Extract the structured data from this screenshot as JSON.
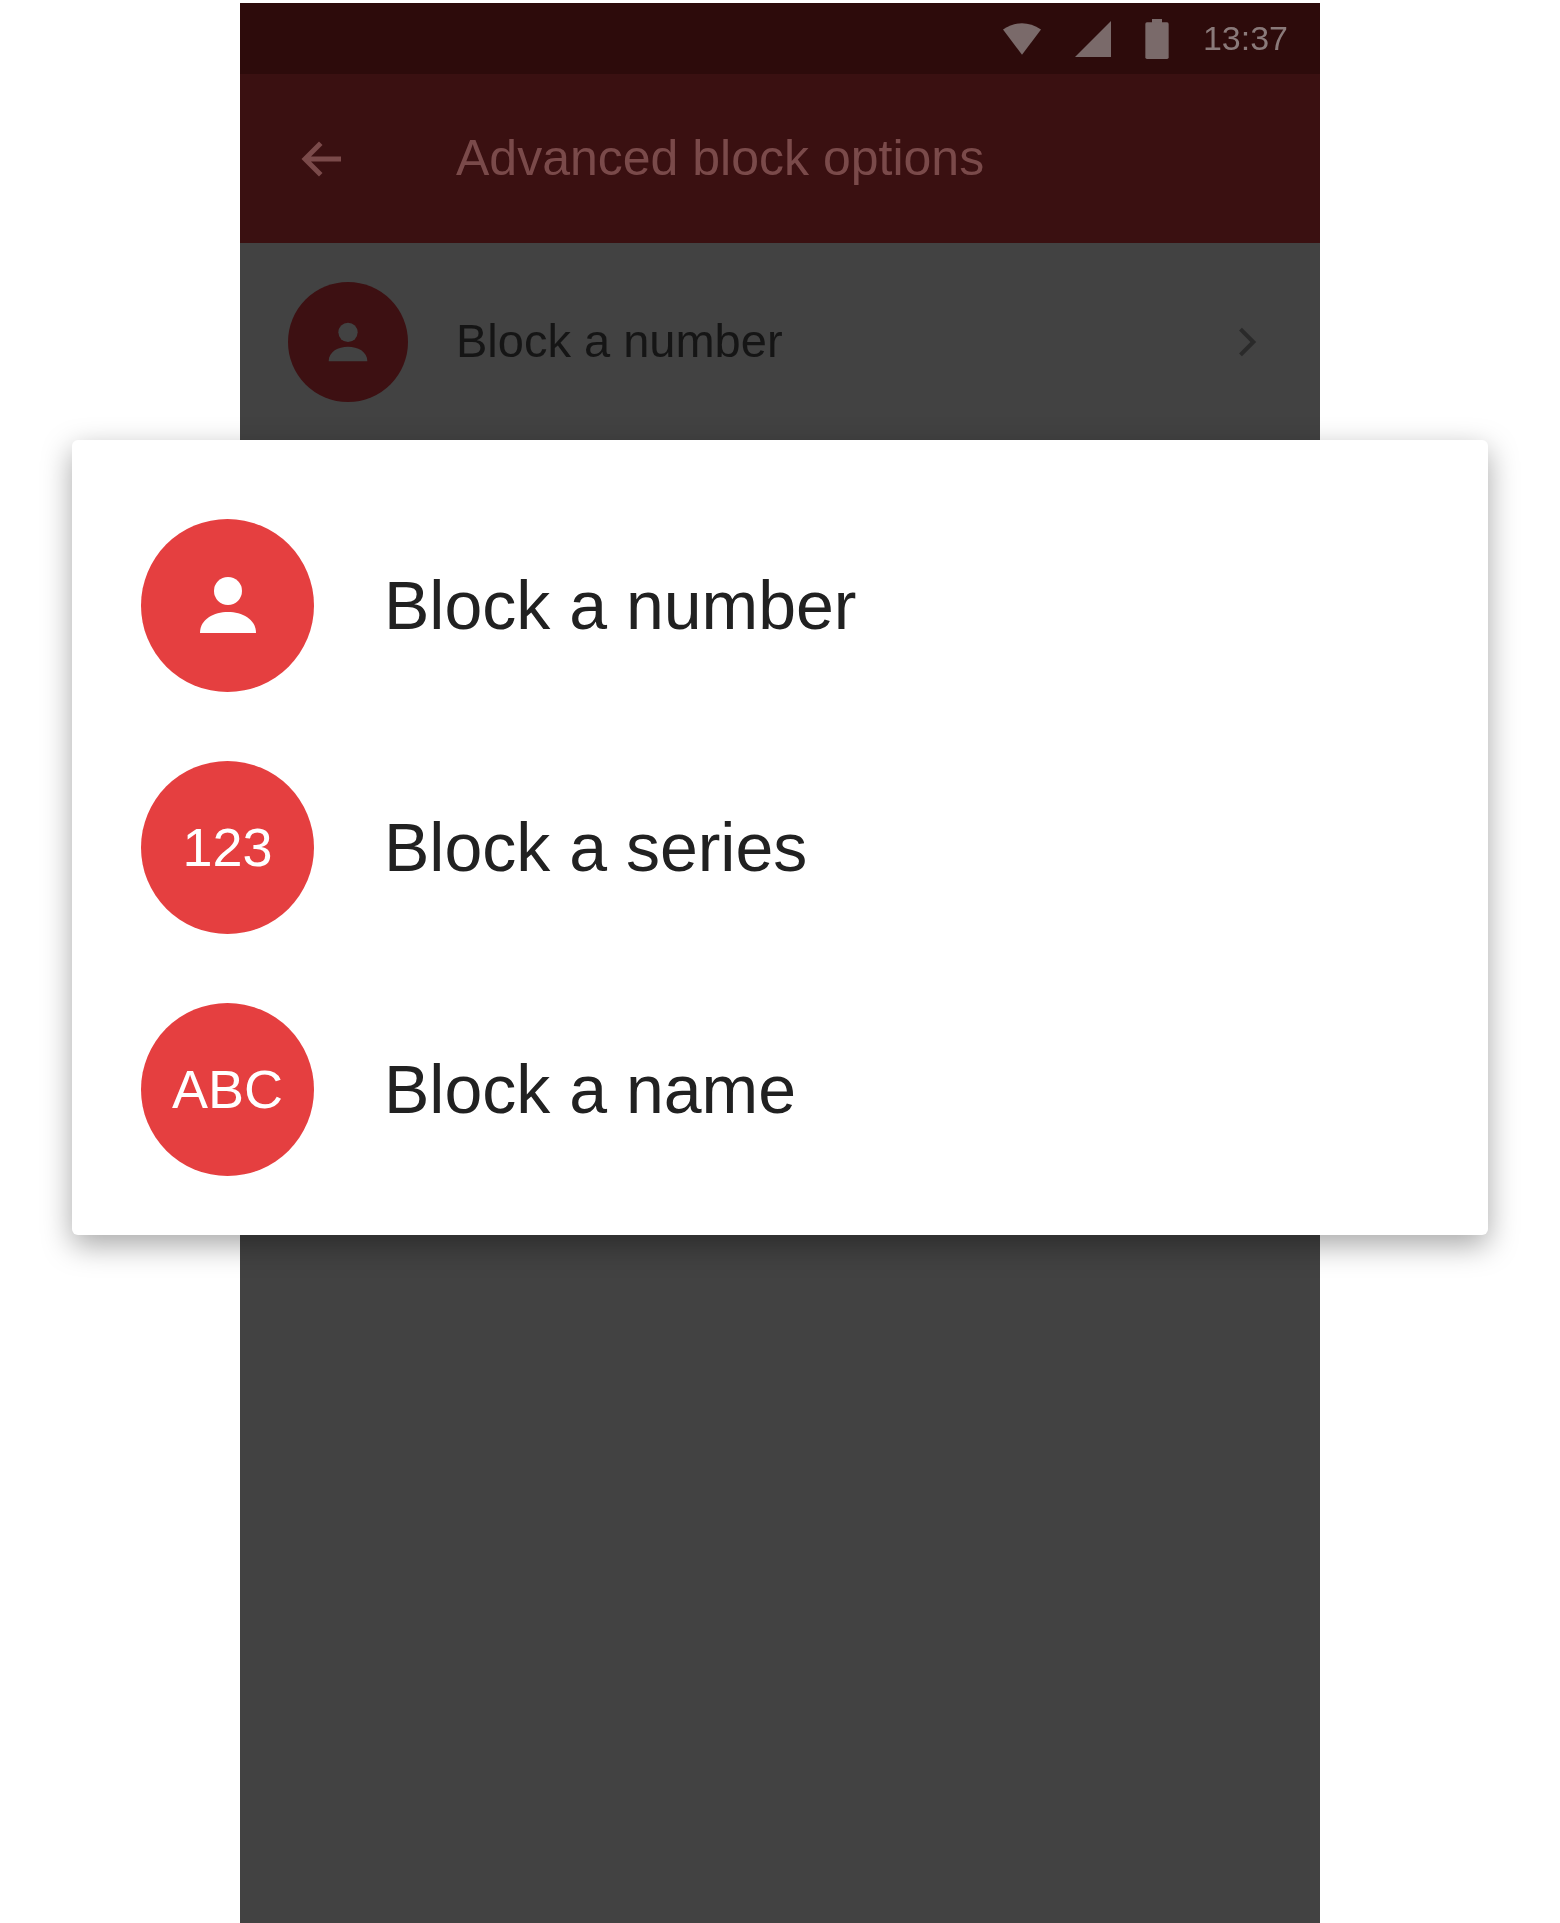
{
  "status_bar": {
    "time": "13:37"
  },
  "app_bar": {
    "title": "Advanced block options"
  },
  "list": [
    {
      "label": "Block a number"
    }
  ],
  "dialog": {
    "options": [
      {
        "kind": "icon",
        "label": "Block a number"
      },
      {
        "kind": "text",
        "badge": "123",
        "label": "Block a series"
      },
      {
        "kind": "text",
        "badge": "ABC",
        "label": "Block a name"
      }
    ]
  }
}
